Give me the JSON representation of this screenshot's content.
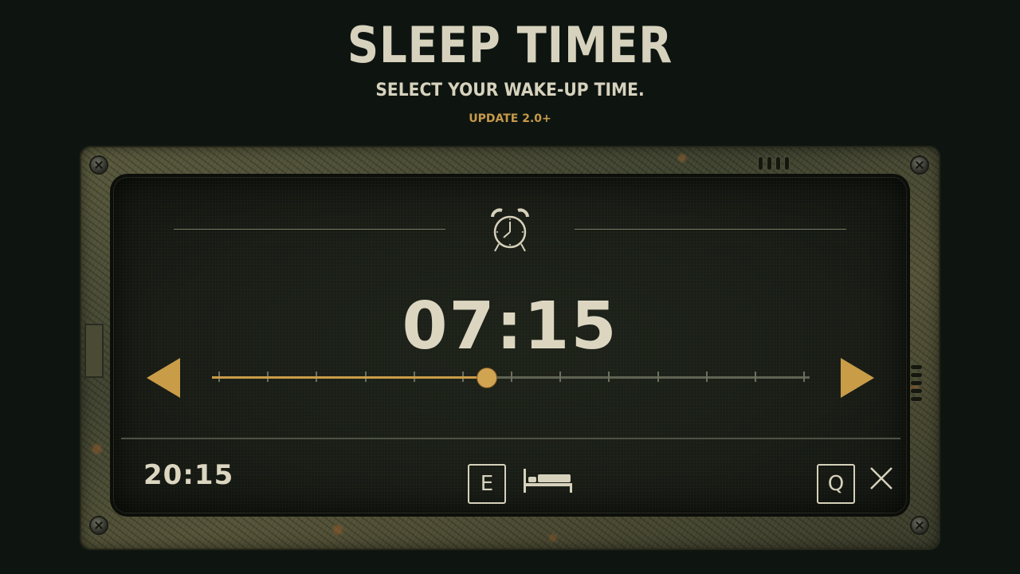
{
  "header": {
    "title": "SLEEP TIMER",
    "subtitle": "SELECT YOUR WAKE-UP TIME.",
    "version": "UPDATE 2.0+"
  },
  "timer": {
    "wake_time": "07:15",
    "current_time": "20:15",
    "slider_position": 0.46,
    "slider_ticks": 13
  },
  "controls": {
    "prev_icon": "arrow-left-icon",
    "next_icon": "arrow-right-icon",
    "confirm_key": "E",
    "cancel_key": "Q",
    "sleep_icon": "bed-icon",
    "close_icon": "close-icon",
    "alarm_icon": "alarm-clock-icon"
  },
  "colors": {
    "accent": "#c99c48",
    "text": "#dcd6c1",
    "background": "#0e1511"
  }
}
